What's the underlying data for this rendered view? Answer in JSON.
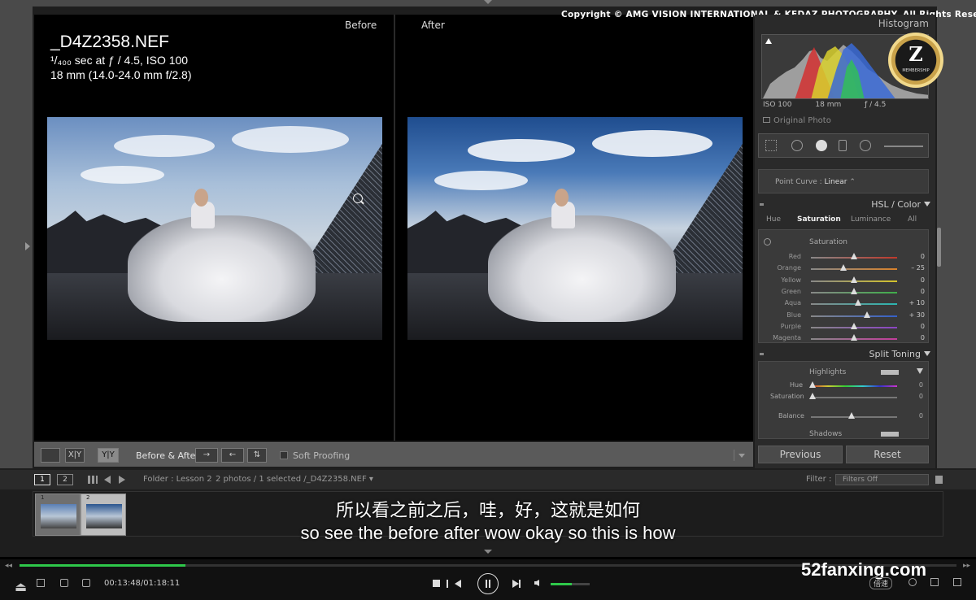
{
  "copyright": "Copyright © AMG VISION INTERNATIONAL & KEDAZ PHOTOGRAPHY. All Rights Reserved.",
  "viewer": {
    "before_label": "Before",
    "after_label": "After",
    "filename": "_D4Z2358.NEF",
    "exposure": "¹/₄₀₀ sec at ƒ / 4.5, ISO 100",
    "lens": "18 mm (14.0-24.0 mm f/2.8)"
  },
  "toolbar": {
    "view_loupe": "",
    "view_xy": "X|Y",
    "view_yy": "Y|Y",
    "before_after_label": "Before & After :",
    "soft_proofing": "Soft Proofing"
  },
  "histogram": {
    "title": "Histogram",
    "iso": "ISO 100",
    "focal": "18 mm",
    "aperture": "ƒ / 4.5",
    "original_photo": "Original Photo"
  },
  "badge": {
    "letter": "Z",
    "text": "MEMBERSHIP"
  },
  "point_curve": {
    "label": "Point Curve :",
    "value": "Linear"
  },
  "hsl": {
    "title": "HSL / Color",
    "tabs": [
      "Hue",
      "Saturation",
      "Luminance",
      "All"
    ],
    "active_tab": "Saturation",
    "section_label": "Saturation",
    "sliders": [
      {
        "name": "Red",
        "value": "0",
        "pos": 0.5,
        "color": "#c0392b"
      },
      {
        "name": "Orange",
        "value": "– 25",
        "pos": 0.38,
        "color": "#d9822b"
      },
      {
        "name": "Yellow",
        "value": "0",
        "pos": 0.5,
        "color": "#d4c32b"
      },
      {
        "name": "Green",
        "value": "0",
        "pos": 0.5,
        "color": "#3fae4a"
      },
      {
        "name": "Aqua",
        "value": "+ 10",
        "pos": 0.55,
        "color": "#2bb5b0"
      },
      {
        "name": "Blue",
        "value": "+ 30",
        "pos": 0.65,
        "color": "#3460c9"
      },
      {
        "name": "Purple",
        "value": "0",
        "pos": 0.5,
        "color": "#8a44c4"
      },
      {
        "name": "Magenta",
        "value": "0",
        "pos": 0.5,
        "color": "#c43c9c"
      }
    ]
  },
  "split_toning": {
    "title": "Split Toning",
    "highlights": "Highlights",
    "hue_label": "Hue",
    "hue_value": "0",
    "sat_label": "Saturation",
    "sat_value": "0",
    "balance_label": "Balance",
    "balance_value": "0",
    "shadows": "Shadows"
  },
  "buttons": {
    "previous": "Previous",
    "reset": "Reset"
  },
  "filmstrip": {
    "page1": "1",
    "page2": "2",
    "folder": "Folder : Lesson 2",
    "selection": "2 photos / 1 selected /_D4Z2358.NEF",
    "filter_label": "Filter :",
    "filter_value": "Filters Off",
    "thumbs": [
      "1",
      "2"
    ]
  },
  "subtitles": {
    "cn": "所以看之前之后，哇，好，这就是如何",
    "en": "so see the before after wow okay so this is how"
  },
  "player": {
    "time": "00:13:48/01:18:11",
    "progress": 0.177,
    "volume": 0.55,
    "watermark": "52fanxing.com",
    "speed": "倍速"
  },
  "colors": {
    "accent": "#2ec84a",
    "panel": "#2a2a2a"
  }
}
